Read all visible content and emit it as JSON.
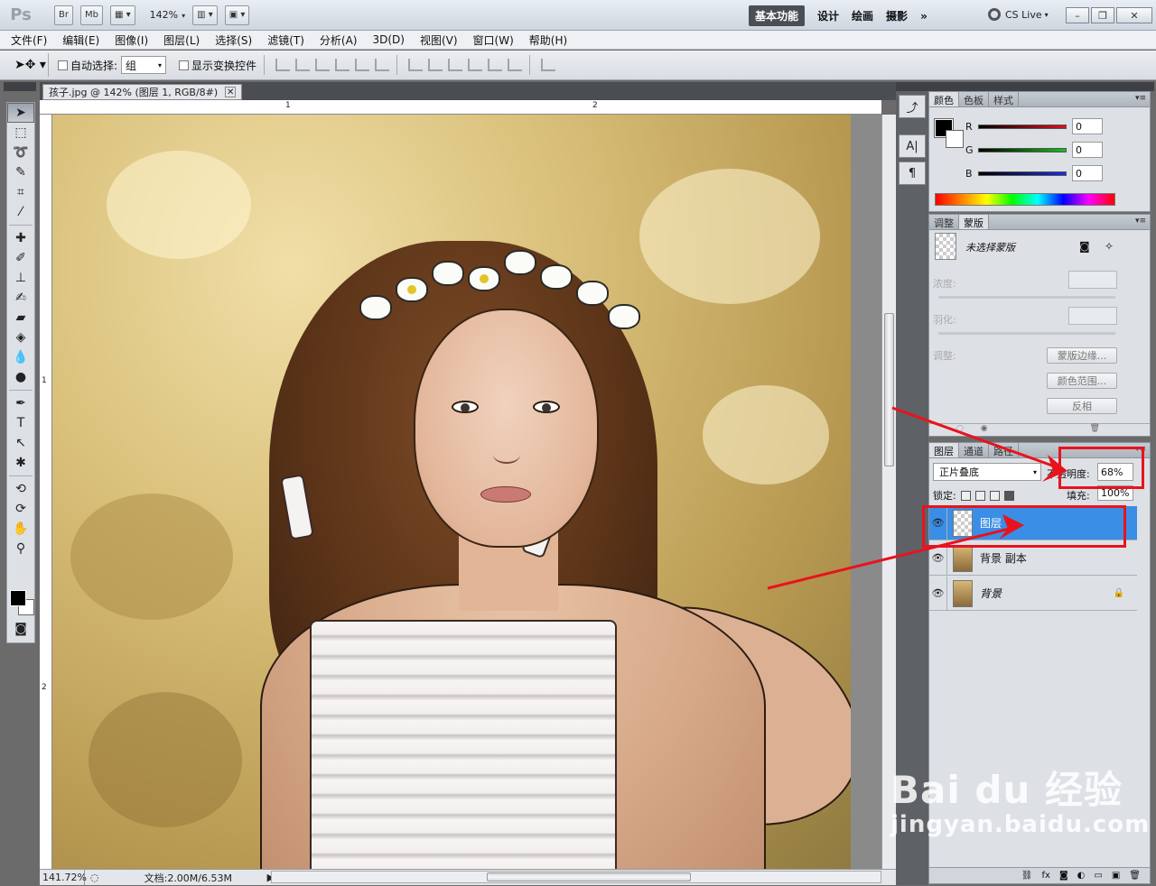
{
  "app": {
    "logo": "Ps",
    "bridge_btn": "Br",
    "minibridge_btn": "Mb",
    "zoom": "142%",
    "workspaces": [
      "基本功能",
      "设计",
      "绘画",
      "摄影"
    ],
    "more_workspaces": "»",
    "cs_live": "CS Live"
  },
  "menu": [
    "文件(F)",
    "编辑(E)",
    "图像(I)",
    "图层(L)",
    "选择(S)",
    "滤镜(T)",
    "分析(A)",
    "3D(D)",
    "视图(V)",
    "窗口(W)",
    "帮助(H)"
  ],
  "options": {
    "auto_select_label": "自动选择:",
    "auto_select_value": "组",
    "show_transform_label": "显示变换控件"
  },
  "document": {
    "tab_title": "孩子.jpg @ 142% (图层 1, RGB/8#)",
    "ruler_top": [
      "1",
      "2"
    ],
    "ruler_left": [
      "1",
      "2"
    ],
    "status_zoom": "141.72%",
    "status_doc": "文档:2.00M/6.53M"
  },
  "color_panel": {
    "tabs": [
      "颜色",
      "色板",
      "样式"
    ],
    "rows": [
      {
        "label": "R",
        "value": "0",
        "color": "#e0101a"
      },
      {
        "label": "G",
        "value": "0",
        "color": "#12c417"
      },
      {
        "label": "B",
        "value": "0",
        "color": "#1a2ee0"
      }
    ]
  },
  "masks_panel": {
    "tabs": [
      "调整",
      "蒙版"
    ],
    "title": "未选择蒙版",
    "density_label": "浓度:",
    "feather_label": "羽化:",
    "adjust_label": "调整:",
    "btn_mask_edge": "蒙版边缘...",
    "btn_color_range": "颜色范围...",
    "btn_invert": "反相"
  },
  "layers_panel": {
    "tabs": [
      "图层",
      "通道",
      "路径"
    ],
    "blend_mode": "正片叠底",
    "opacity_label": "不透明度:",
    "opacity_value": "68%",
    "lock_label": "锁定:",
    "fill_label": "填充:",
    "fill_value": "100%",
    "layers": [
      {
        "name": "图层",
        "selected": true,
        "thumb": "transparent",
        "locked": false,
        "italic": false
      },
      {
        "name": "背景 副本",
        "selected": false,
        "thumb": "photo",
        "locked": false,
        "italic": false
      },
      {
        "name": "背景",
        "selected": false,
        "thumb": "photo",
        "locked": true,
        "italic": true
      }
    ]
  },
  "watermark": {
    "brand": "Bai du 经验",
    "url": "jingyan.baidu.com"
  },
  "colors": {
    "accent_selected": "#3a8ee6",
    "annotation": "#e8131d"
  }
}
